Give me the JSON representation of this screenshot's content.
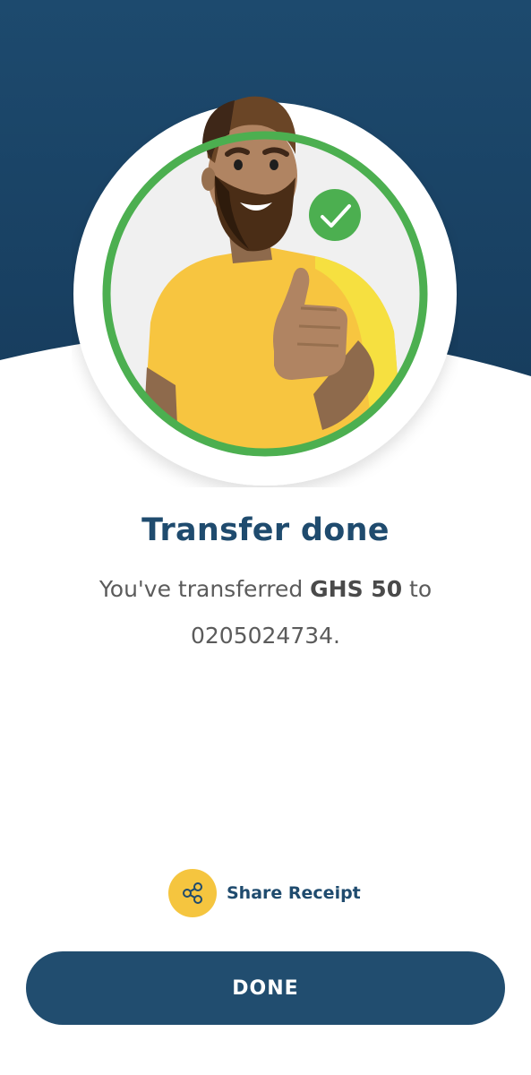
{
  "colors": {
    "header_bg": "#1c4468",
    "accent_yellow": "#f5c53f",
    "success_green": "#4caf50",
    "primary_blue": "#214d6f"
  },
  "confirmation": {
    "title": "Transfer done",
    "message_prefix": "You've transferred ",
    "amount": "GHS 50",
    "message_middle": " to",
    "recipient": "0205024734."
  },
  "actions": {
    "share_icon": "share-icon",
    "share_label": "Share Receipt",
    "done_label": "DONE"
  }
}
